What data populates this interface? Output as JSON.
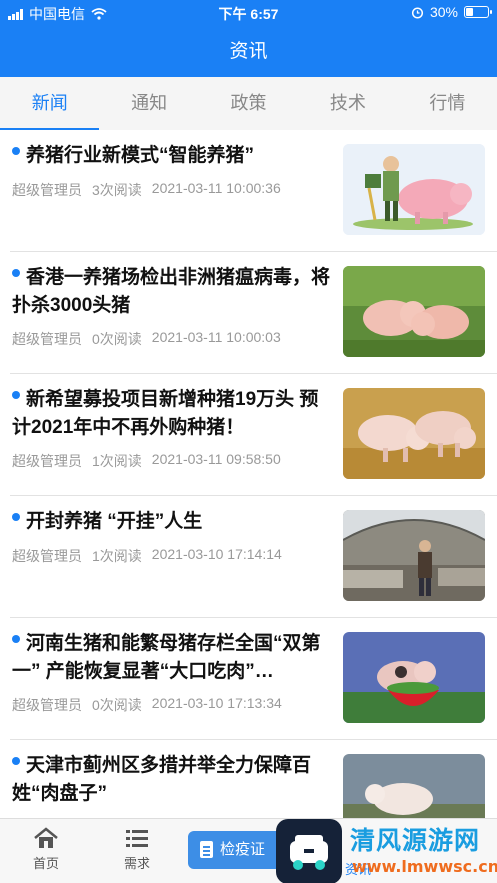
{
  "status_bar": {
    "carrier": "中国电信",
    "time": "下午 6:57",
    "battery": "30%"
  },
  "header": {
    "title": "资讯"
  },
  "tabs": [
    {
      "label": "新闻",
      "active": true
    },
    {
      "label": "通知",
      "active": false
    },
    {
      "label": "政策",
      "active": false
    },
    {
      "label": "技术",
      "active": false
    },
    {
      "label": "行情",
      "active": false
    }
  ],
  "news": [
    {
      "title": "养猪行业新模式“智能养猪”",
      "author": "超级管理员",
      "reads": "3次阅读",
      "time": "2021-03-11 10:00:36"
    },
    {
      "title": "香港一养猪场检出非洲猪瘟病毒，将扑杀3000头猪",
      "author": "超级管理员",
      "reads": "0次阅读",
      "time": "2021-03-11 10:00:03"
    },
    {
      "title": "新希望募投项目新增种猪19万头 预计2021年中不再外购种猪！",
      "author": "超级管理员",
      "reads": "1次阅读",
      "time": "2021-03-11 09:58:50"
    },
    {
      "title": "开封养猪 “开挂”人生",
      "author": "超级管理员",
      "reads": "1次阅读",
      "time": "2021-03-10 17:14:14"
    },
    {
      "title": "河南生猪和能繁母猪存栏全国“双第一” 产能恢复显著“大口吃肉”…",
      "author": "超级管理员",
      "reads": "0次阅读",
      "time": "2021-03-10 17:13:34"
    },
    {
      "title": "天津市蓟州区多措并举全力保障百姓“肉盘子”",
      "author": "",
      "reads": "",
      "time": ""
    }
  ],
  "tabbar": {
    "home": "首页",
    "demand": "需求",
    "quarantine": "检疫证",
    "info": "资讯"
  },
  "watermark": {
    "name": "清风源游网",
    "url": "www.lmwwsc.cn"
  },
  "colors": {
    "primary": "#1a80f5"
  }
}
